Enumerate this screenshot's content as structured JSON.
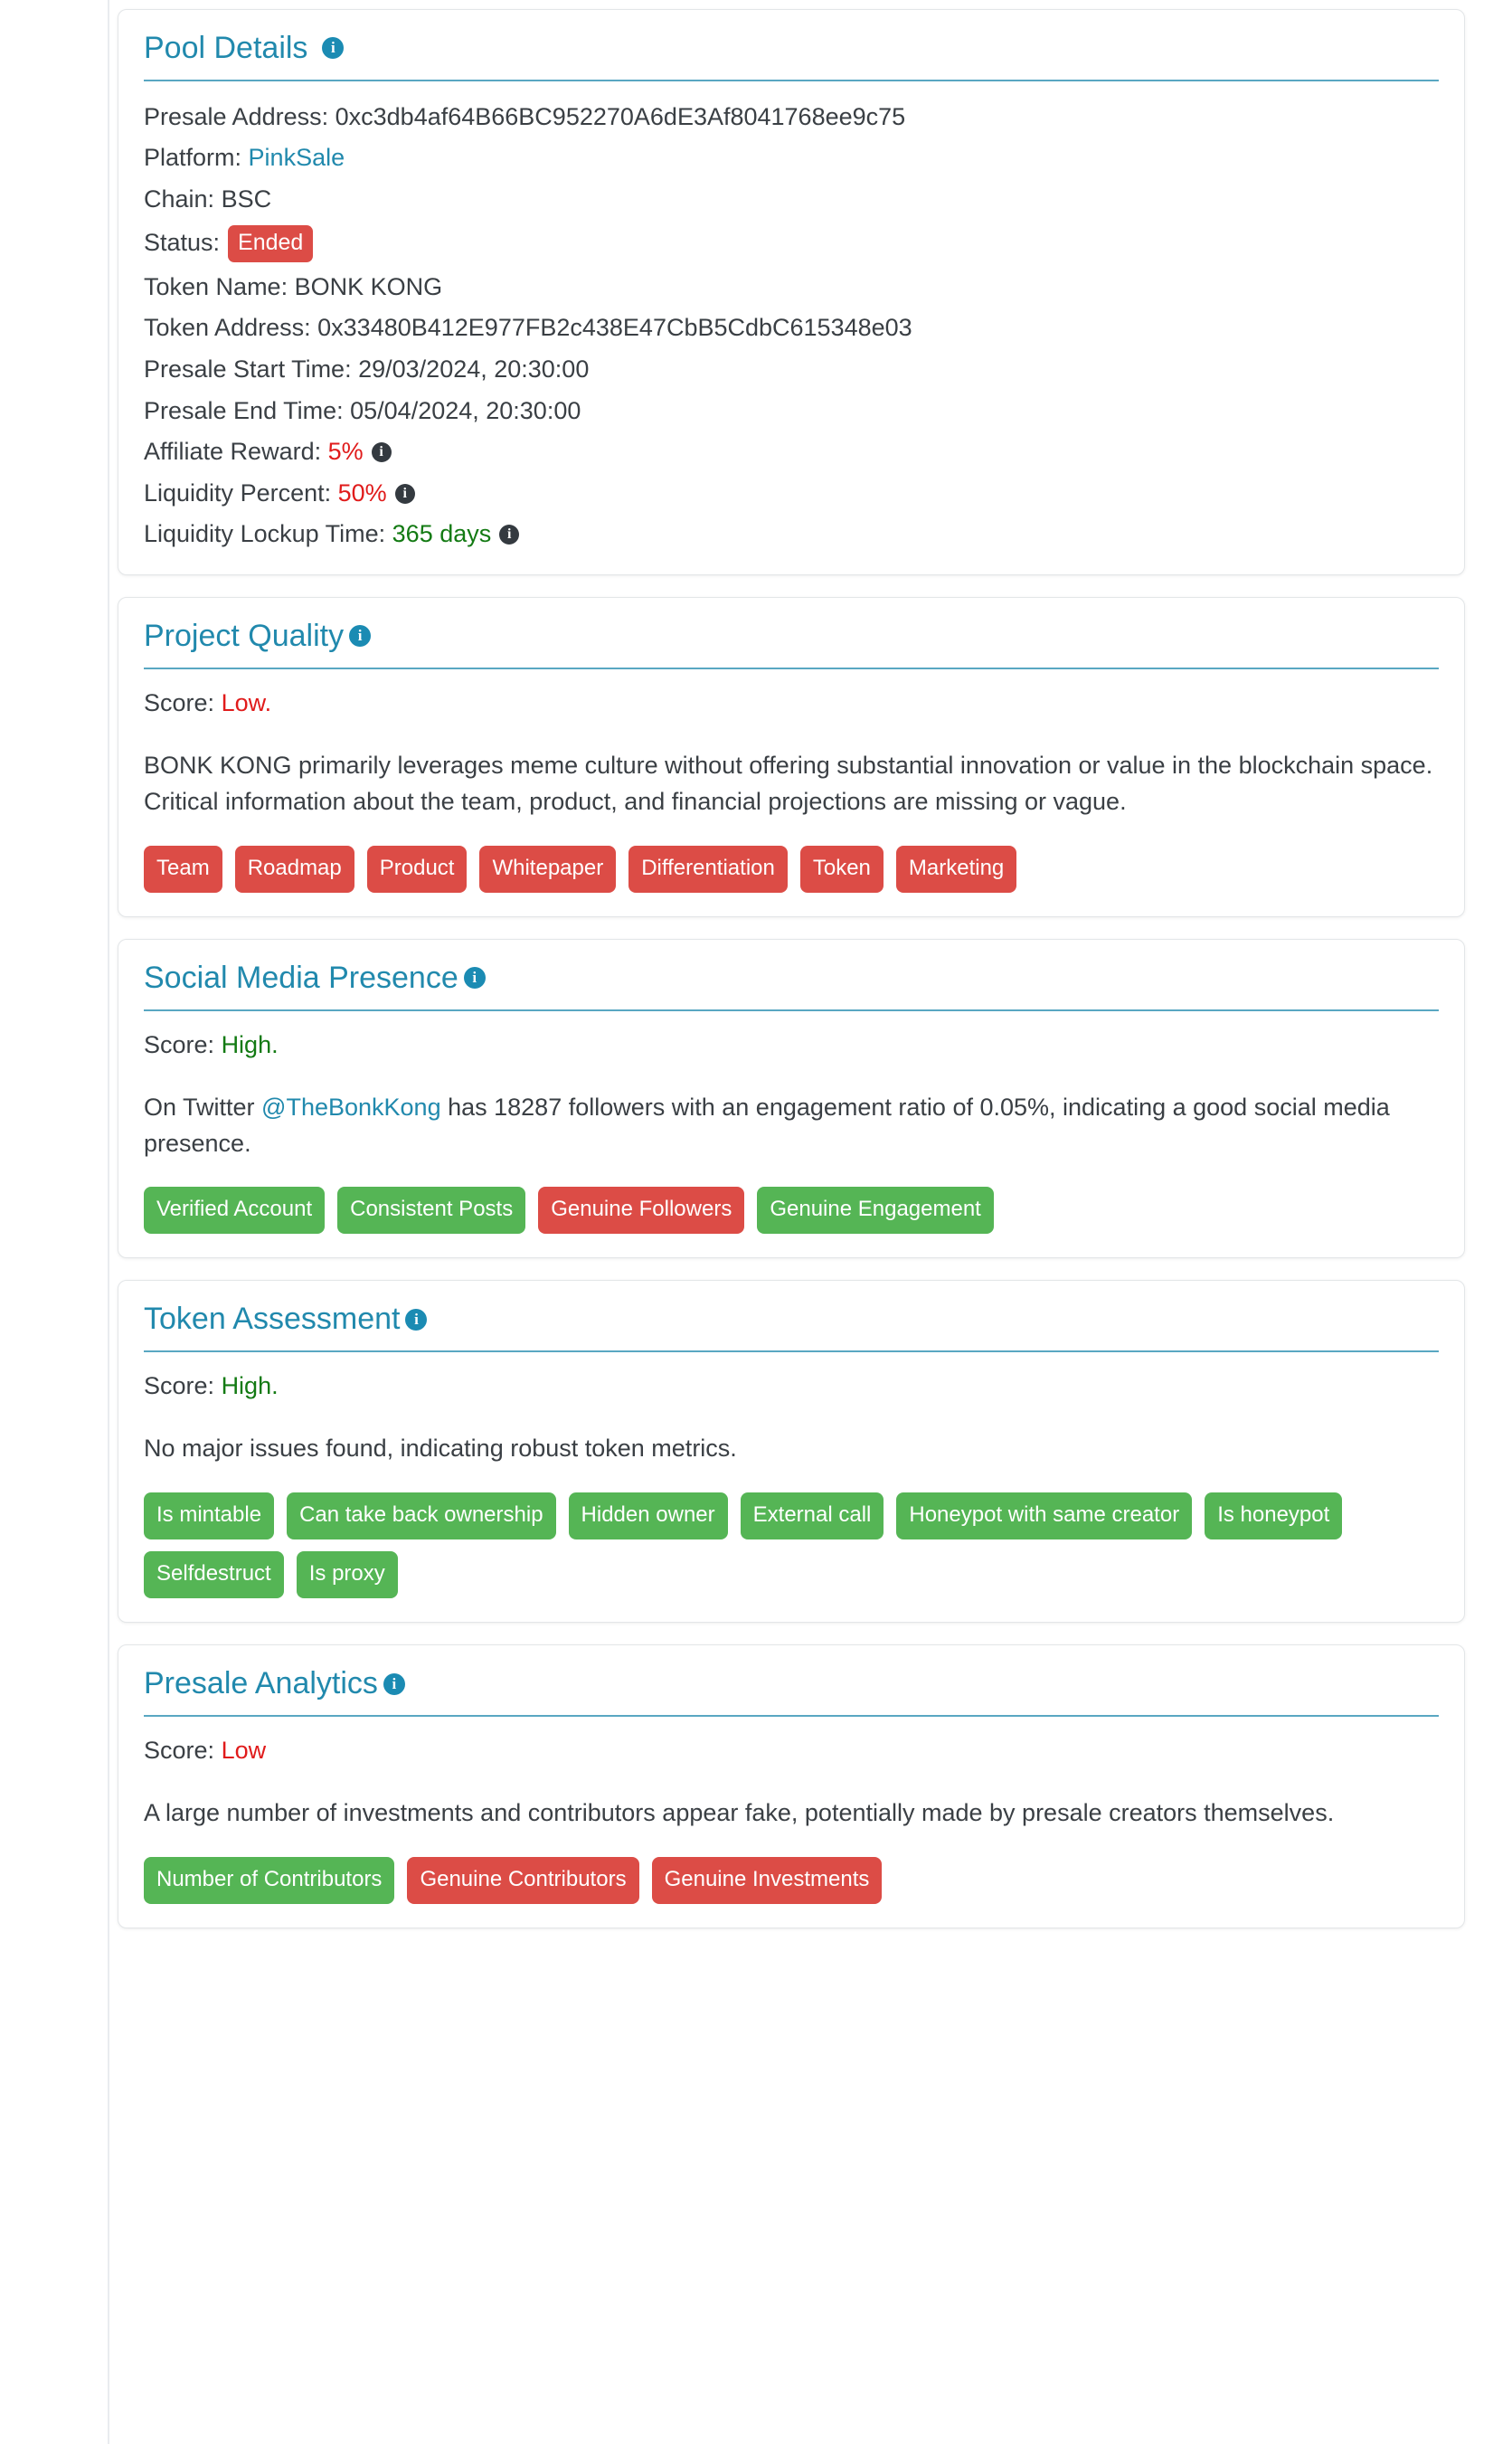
{
  "icons": {
    "info": "i",
    "info_name": "info-icon"
  },
  "colors": {
    "accent": "#2189ad",
    "danger": "#dc4c46",
    "success": "#55b555",
    "value_red": "#e01b1b",
    "value_green": "#137a13"
  },
  "pool_details": {
    "title": "Pool Details",
    "rows": [
      {
        "label": "Presale Address:",
        "value": "0xc3db4af64B66BC952270A6dE3Af8041768ee9c75"
      },
      {
        "label": "Platform:",
        "value": "PinkSale"
      },
      {
        "label": "Chain:",
        "value": "BSC"
      },
      {
        "label": "Status:",
        "value": "Ended"
      },
      {
        "label": "Token Name:",
        "value": "BONK KONG"
      },
      {
        "label": "Token Address:",
        "value": "0x33480B412E977FB2c438E47CbB5CdbC615348e03"
      },
      {
        "label": "Presale Start Time:",
        "value": "29/03/2024, 20:30:00"
      },
      {
        "label": "Presale End Time:",
        "value": "05/04/2024, 20:30:00"
      },
      {
        "label": "Affiliate Reward:",
        "value": "5%"
      },
      {
        "label": "Liquidity Percent:",
        "value": "50%"
      },
      {
        "label": "Liquidity Lockup Time:",
        "value": "365 days"
      }
    ]
  },
  "project_quality": {
    "title": "Project Quality",
    "score_label": "Score:",
    "score_value": "Low.",
    "description": "BONK KONG primarily leverages meme culture without offering substantial innovation or value in the blockchain space. Critical information about the team, product, and financial projections are missing or vague.",
    "tags": [
      {
        "label": "Team",
        "state": "red"
      },
      {
        "label": "Roadmap",
        "state": "red"
      },
      {
        "label": "Product",
        "state": "red"
      },
      {
        "label": "Whitepaper",
        "state": "red"
      },
      {
        "label": "Differentiation",
        "state": "red"
      },
      {
        "label": "Token",
        "state": "red"
      },
      {
        "label": "Marketing",
        "state": "red"
      }
    ]
  },
  "social_media_presence": {
    "title": "Social Media Presence",
    "score_label": "Score:",
    "score_value": "High.",
    "description_pre": "On Twitter ",
    "handle": "@TheBonkKong",
    "description_post": " has 18287 followers with an engagement ratio of 0.05%, indicating a good social media presence.",
    "followers": "18287",
    "engagement_ratio": "0.05%",
    "tags": [
      {
        "label": "Verified Account",
        "state": "green"
      },
      {
        "label": "Consistent Posts",
        "state": "green"
      },
      {
        "label": "Genuine Followers",
        "state": "red"
      },
      {
        "label": "Genuine Engagement",
        "state": "green"
      }
    ]
  },
  "token_assessment": {
    "title": "Token Assessment",
    "score_label": "Score:",
    "score_value": "High.",
    "description": "No major issues found, indicating robust token metrics.",
    "tags": [
      {
        "label": "Is mintable",
        "state": "green"
      },
      {
        "label": "Can take back ownership",
        "state": "green"
      },
      {
        "label": "Hidden owner",
        "state": "green"
      },
      {
        "label": "External call",
        "state": "green"
      },
      {
        "label": "Honeypot with same creator",
        "state": "green"
      },
      {
        "label": "Is honeypot",
        "state": "green"
      },
      {
        "label": "Selfdestruct",
        "state": "green"
      },
      {
        "label": "Is proxy",
        "state": "green"
      }
    ]
  },
  "presale_analytics": {
    "title": "Presale Analytics",
    "score_label": "Score:",
    "score_value": "Low",
    "description": "A large number of investments and contributors appear fake, potentially made by presale creators themselves.",
    "tags": [
      {
        "label": "Number of Contributors",
        "state": "green"
      },
      {
        "label": "Genuine Contributors",
        "state": "red"
      },
      {
        "label": "Genuine Investments",
        "state": "red"
      }
    ]
  }
}
